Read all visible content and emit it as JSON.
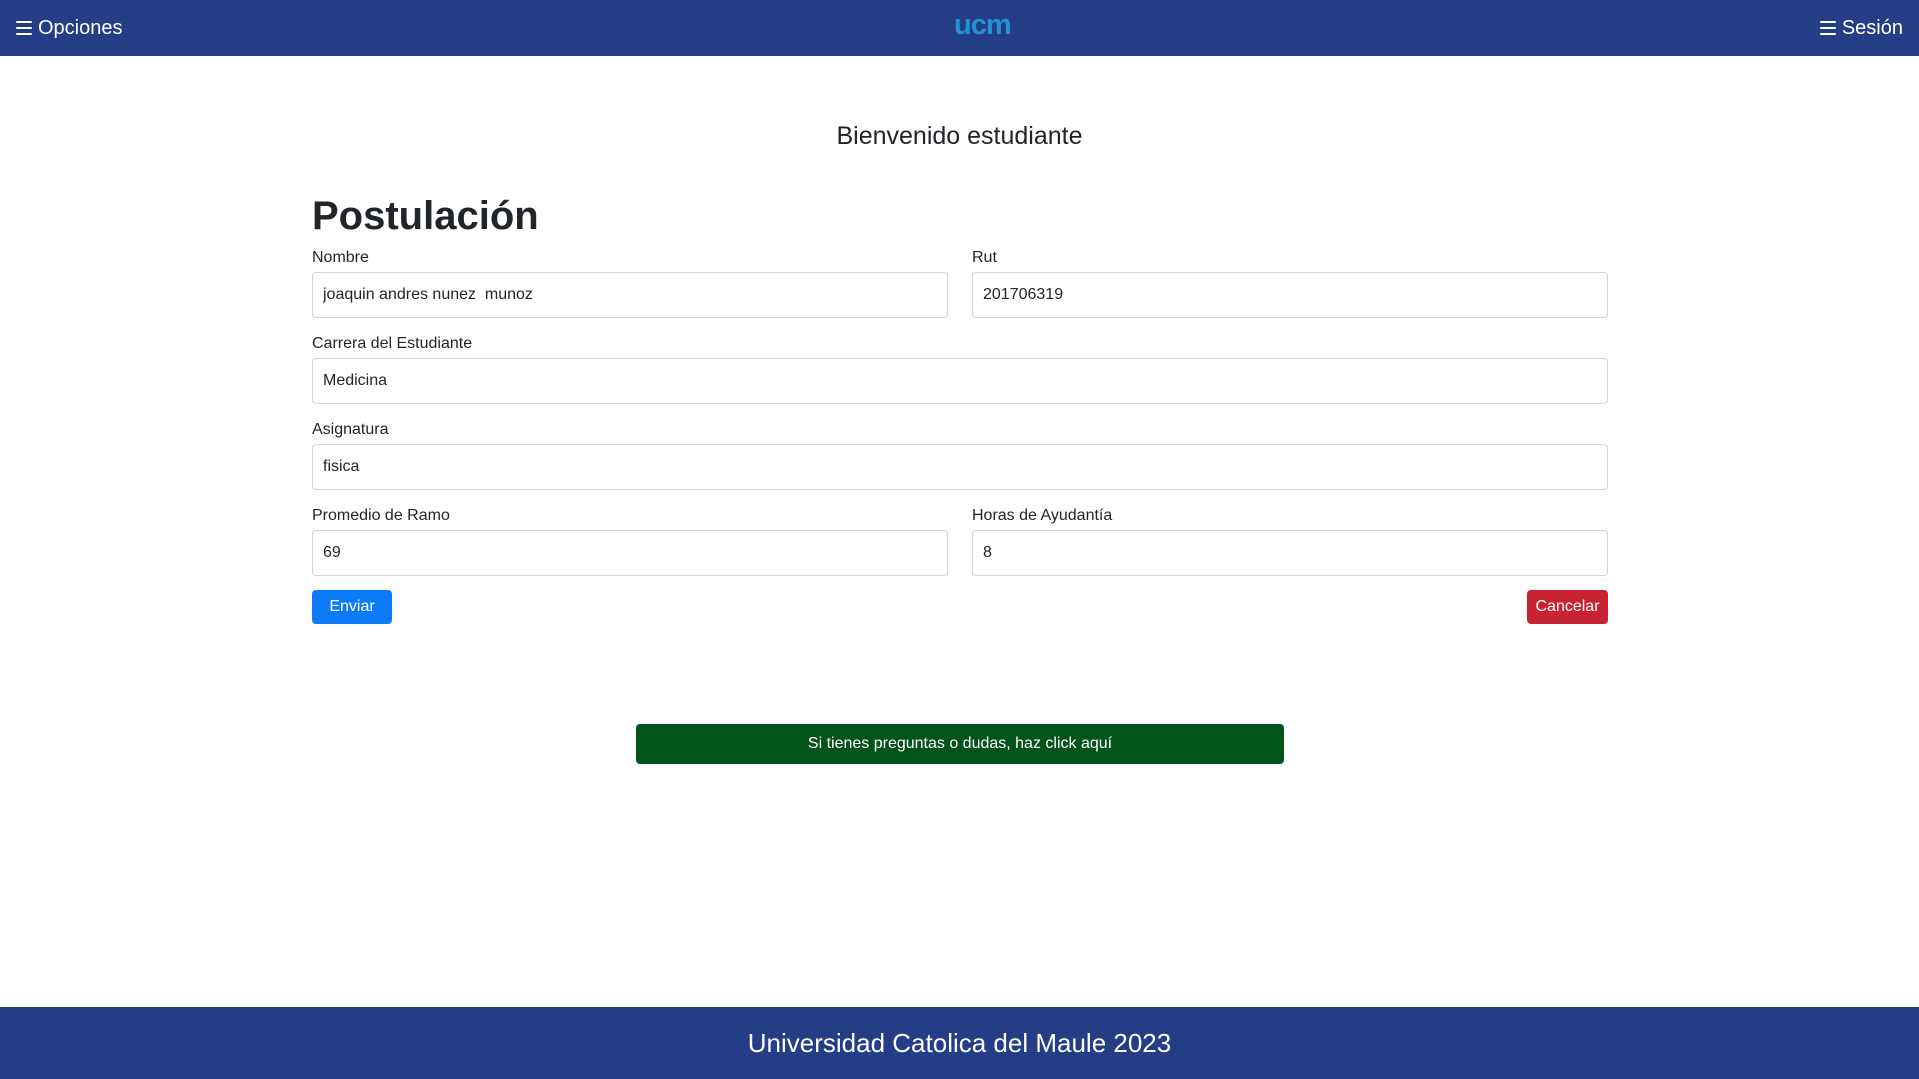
{
  "navbar": {
    "left_label": "Opciones",
    "logo_text": "ucm",
    "right_label": "Sesión"
  },
  "main": {
    "welcome": "Bienvenido estudiante",
    "form_title": "Postulación",
    "fields": {
      "nombre": {
        "label": "Nombre",
        "value": "joaquin andres nunez  munoz"
      },
      "rut": {
        "label": "Rut",
        "value": "201706319"
      },
      "carrera": {
        "label": "Carrera del Estudiante",
        "value": "Medicina"
      },
      "asignatura": {
        "label": "Asignatura",
        "value": "fisica"
      },
      "promedio": {
        "label": "Promedio de Ramo",
        "value": "69"
      },
      "horas": {
        "label": "Horas de Ayudantía",
        "value": "8"
      }
    },
    "submit_label": "Enviar",
    "cancel_label": "Cancelar",
    "help_label": "Si tienes preguntas o dudas, haz click aquí"
  },
  "footer": {
    "text": "Universidad Catolica del Maule 2023"
  },
  "colors": {
    "navbar_bg": "#253c87",
    "logo": "#1f93d6",
    "primary": "#0d7bf5",
    "danger": "#c82333",
    "help_bg": "#03531a"
  },
  "icons": {
    "menu": "hamburger-menu-icon"
  }
}
